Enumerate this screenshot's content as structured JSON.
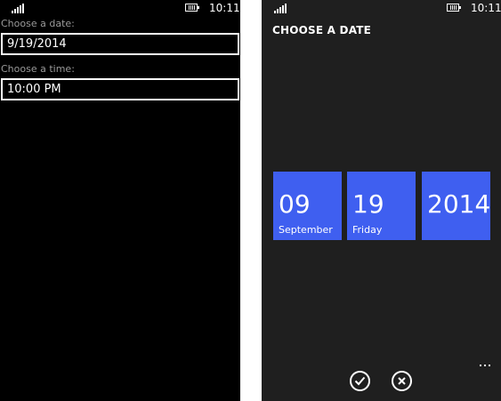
{
  "status_bar": {
    "time": "10:11",
    "signal_icon": "signal-strength-icon",
    "battery_icon": "battery-icon"
  },
  "date_time_form": {
    "date_label": "Choose a date:",
    "date_value": "9/19/2014",
    "time_label": "Choose a time:",
    "time_value": "10:00 PM"
  },
  "date_picker": {
    "title": "CHOOSE A DATE",
    "month": {
      "number": "09",
      "name": "September"
    },
    "day": {
      "number": "19",
      "name": "Friday"
    },
    "year": {
      "number": "2014"
    },
    "accent_color": "#3f5ff0",
    "background_color": "#1f1f1f"
  },
  "app_bar": {
    "accept_icon": "checkmark-icon",
    "cancel_icon": "close-icon",
    "more_icon": "ellipsis-icon"
  }
}
